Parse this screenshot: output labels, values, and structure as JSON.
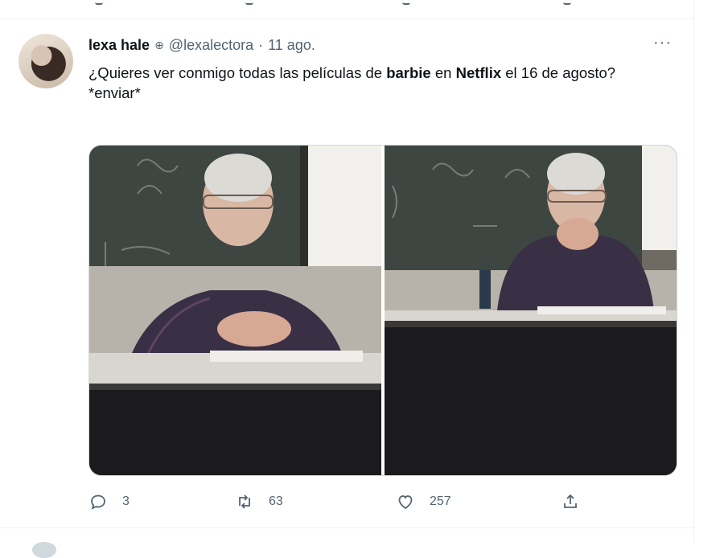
{
  "tweet": {
    "author_name": "lexa hale",
    "author_handle": "@lexalectora",
    "separator": "·",
    "date": "11 ago.",
    "more_label": "···",
    "text": {
      "part1": "¿Quieres ver conmigo todas las películas de ",
      "bold1": "barbie",
      "part2": " en ",
      "bold2": "Netflix",
      "part3": " el 16 de agosto?",
      "line2": "*enviar*"
    },
    "stats": {
      "replies": "3",
      "retweets": "63",
      "likes": "257"
    }
  },
  "icons": {
    "verified": "globe-icon",
    "reply": "reply-icon",
    "retweet": "retweet-icon",
    "like": "heart-icon",
    "share": "share-icon"
  },
  "colors": {
    "text": "#0f1419",
    "muted": "#536471",
    "border": "#eff3f4"
  }
}
